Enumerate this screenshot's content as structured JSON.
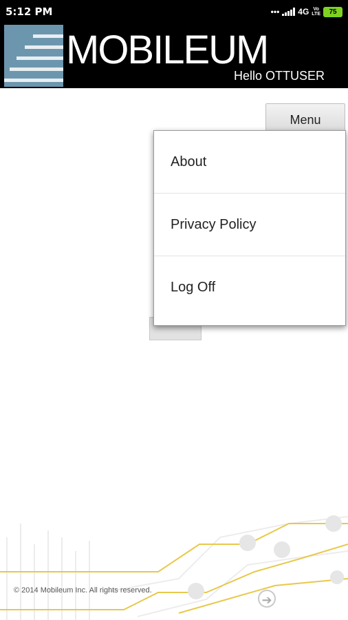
{
  "status_bar": {
    "time": "5:12 PM",
    "dots": "•••",
    "network": "4G",
    "volte_top": "Vo",
    "volte_bottom": "LTE",
    "battery": "75"
  },
  "header": {
    "brand": "MOBILEUM",
    "greeting": "Hello OTTUSER"
  },
  "menu_button": {
    "label": "Menu"
  },
  "menu": {
    "items": [
      {
        "label": "About"
      },
      {
        "label": "Privacy Policy"
      },
      {
        "label": "Log Off"
      }
    ]
  },
  "footer": {
    "copyright": "© 2014 Mobileum Inc. All rights reserved.",
    "next_icon": "arrow-right-icon"
  },
  "colors": {
    "header_bg": "#000000",
    "logo_block": "#6c96ad",
    "circuit_yellow": "#e8c84a",
    "battery_green": "#7ed321"
  }
}
